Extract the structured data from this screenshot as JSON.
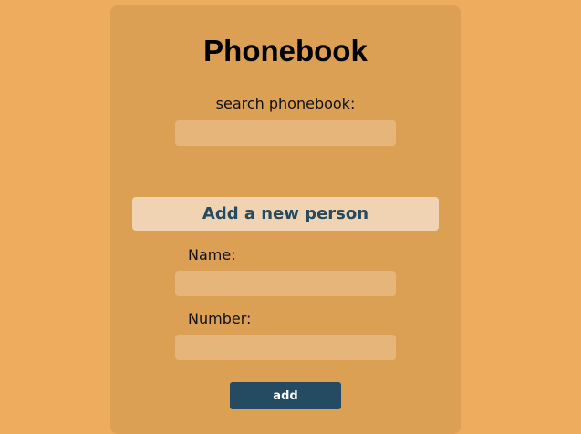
{
  "page": {
    "title": "Phonebook"
  },
  "search": {
    "label": "search phonebook:",
    "value": "",
    "placeholder": ""
  },
  "add_person": {
    "heading": "Add a new person",
    "name_label": "Name:",
    "name_value": "",
    "number_label": "Number:",
    "number_value": "",
    "submit_label": "add"
  },
  "colors": {
    "background": "#eeac5e",
    "card": "#dba053",
    "input": "#e6b57a",
    "heading_bg": "#efd3b2",
    "accent": "#244b61"
  }
}
